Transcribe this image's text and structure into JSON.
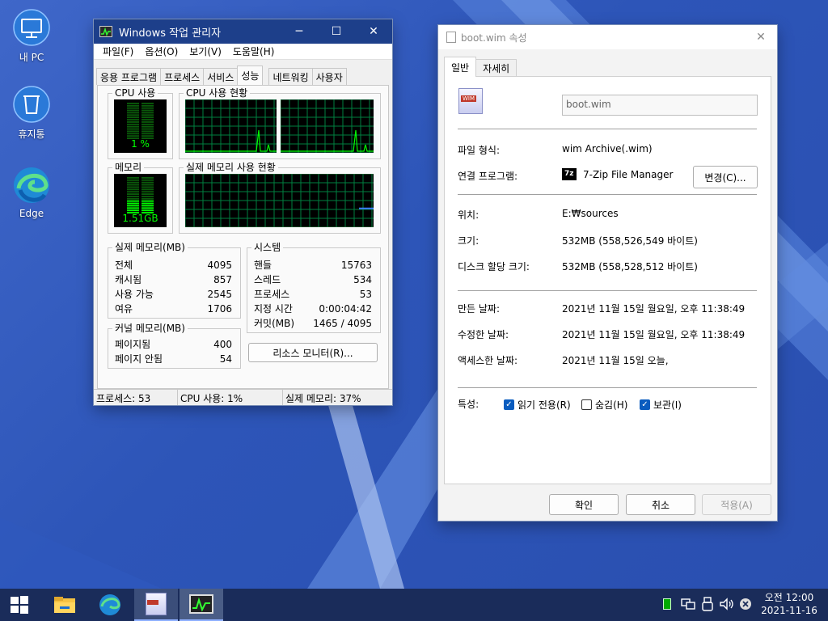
{
  "desktop": {
    "icons": [
      {
        "label": "내 PC",
        "icon": "monitor-icon"
      },
      {
        "label": "휴지통",
        "icon": "recycle-bin-icon"
      },
      {
        "label": "Edge",
        "icon": "edge-icon"
      }
    ]
  },
  "taskmgr": {
    "title": "Windows 작업 관리자",
    "menu": [
      "파일(F)",
      "옵션(O)",
      "보기(V)",
      "도움말(H)"
    ],
    "tabs": [
      "응용 프로그램",
      "프로세스",
      "서비스",
      "성능",
      "네트워킹",
      "사용자"
    ],
    "active_tab": "성능",
    "cpu_usage_label": "CPU 사용",
    "cpu_usage_value": "1 %",
    "cpu_usage_percent": 1,
    "cpu_history_label": "CPU 사용 현황",
    "mem_label": "메모리",
    "mem_value": "1.51GB",
    "mem_fraction": 0.37,
    "mem_history_label": "실제 메모리 사용 현황",
    "physical": {
      "title": "실제 메모리(MB)",
      "rows": [
        {
          "k": "전체",
          "v": "4095"
        },
        {
          "k": "캐시됨",
          "v": "857"
        },
        {
          "k": "사용 가능",
          "v": "2545"
        },
        {
          "k": "여유",
          "v": "1706"
        }
      ]
    },
    "kernel": {
      "title": "커널 메모리(MB)",
      "rows": [
        {
          "k": "페이지됨",
          "v": "400"
        },
        {
          "k": "페이지 안됨",
          "v": "54"
        }
      ]
    },
    "system": {
      "title": "시스템",
      "rows": [
        {
          "k": "핸들",
          "v": "15763"
        },
        {
          "k": "스레드",
          "v": "534"
        },
        {
          "k": "프로세스",
          "v": "53"
        },
        {
          "k": "지정 시간",
          "v": "0:00:04:42"
        },
        {
          "k": "커밋(MB)",
          "v": "1465 / 4095"
        }
      ]
    },
    "resource_monitor_btn": "리소스 모니터(R)...",
    "status": {
      "processes": "프로세스: 53",
      "cpu": "CPU 사용: 1%",
      "memory": "실제 메모리: 37%"
    },
    "colors": {
      "graph_green": "#00ff00",
      "grid": "#008040",
      "title_bg": "#1d3f8a"
    }
  },
  "props": {
    "title": "boot.wim 속성",
    "tabs": [
      "일반",
      "자세히"
    ],
    "file_icon_label": "WIM",
    "filename": "boot.wim",
    "rows1": [
      {
        "k": "파일 형식:",
        "v": "wim Archive(.wim)"
      },
      {
        "k": "연결 프로그램:",
        "v": "7-Zip File Manager"
      }
    ],
    "change_btn": "변경(C)...",
    "app_icon_label": "7z",
    "rows2": [
      {
        "k": "위치:",
        "v": "E:₩sources"
      },
      {
        "k": "크기:",
        "v": "532MB (558,526,549 바이트)"
      },
      {
        "k": "디스크 할당 크기:",
        "v": "532MB (558,528,512 바이트)"
      }
    ],
    "rows3": [
      {
        "k": "만든 날짜:",
        "v": "2021년 11월 15일 월요일, 오후 11:38:49"
      },
      {
        "k": "수정한 날짜:",
        "v": "2021년 11월 15일 월요일, 오후 11:38:49"
      },
      {
        "k": "액세스한 날짜:",
        "v": "2021년 11월 15일 오늘,"
      }
    ],
    "attr_label": "특성:",
    "attrs": [
      {
        "label": "읽기 전용(R)",
        "checked": true
      },
      {
        "label": "숨김(H)",
        "checked": false
      },
      {
        "label": "보관(I)",
        "checked": true
      }
    ],
    "ok": "확인",
    "cancel": "취소",
    "apply": "적용(A)"
  },
  "taskbar": {
    "time": "오전 12:00",
    "date": "2021-11-16",
    "items": [
      "start-icon",
      "file-explorer-icon",
      "edge-icon",
      "wim-file-icon",
      "task-manager-icon"
    ],
    "tray": [
      "taskmgr-tray-icon",
      "network-icon",
      "usb-icon",
      "volume-icon",
      "close-circle-icon"
    ]
  }
}
